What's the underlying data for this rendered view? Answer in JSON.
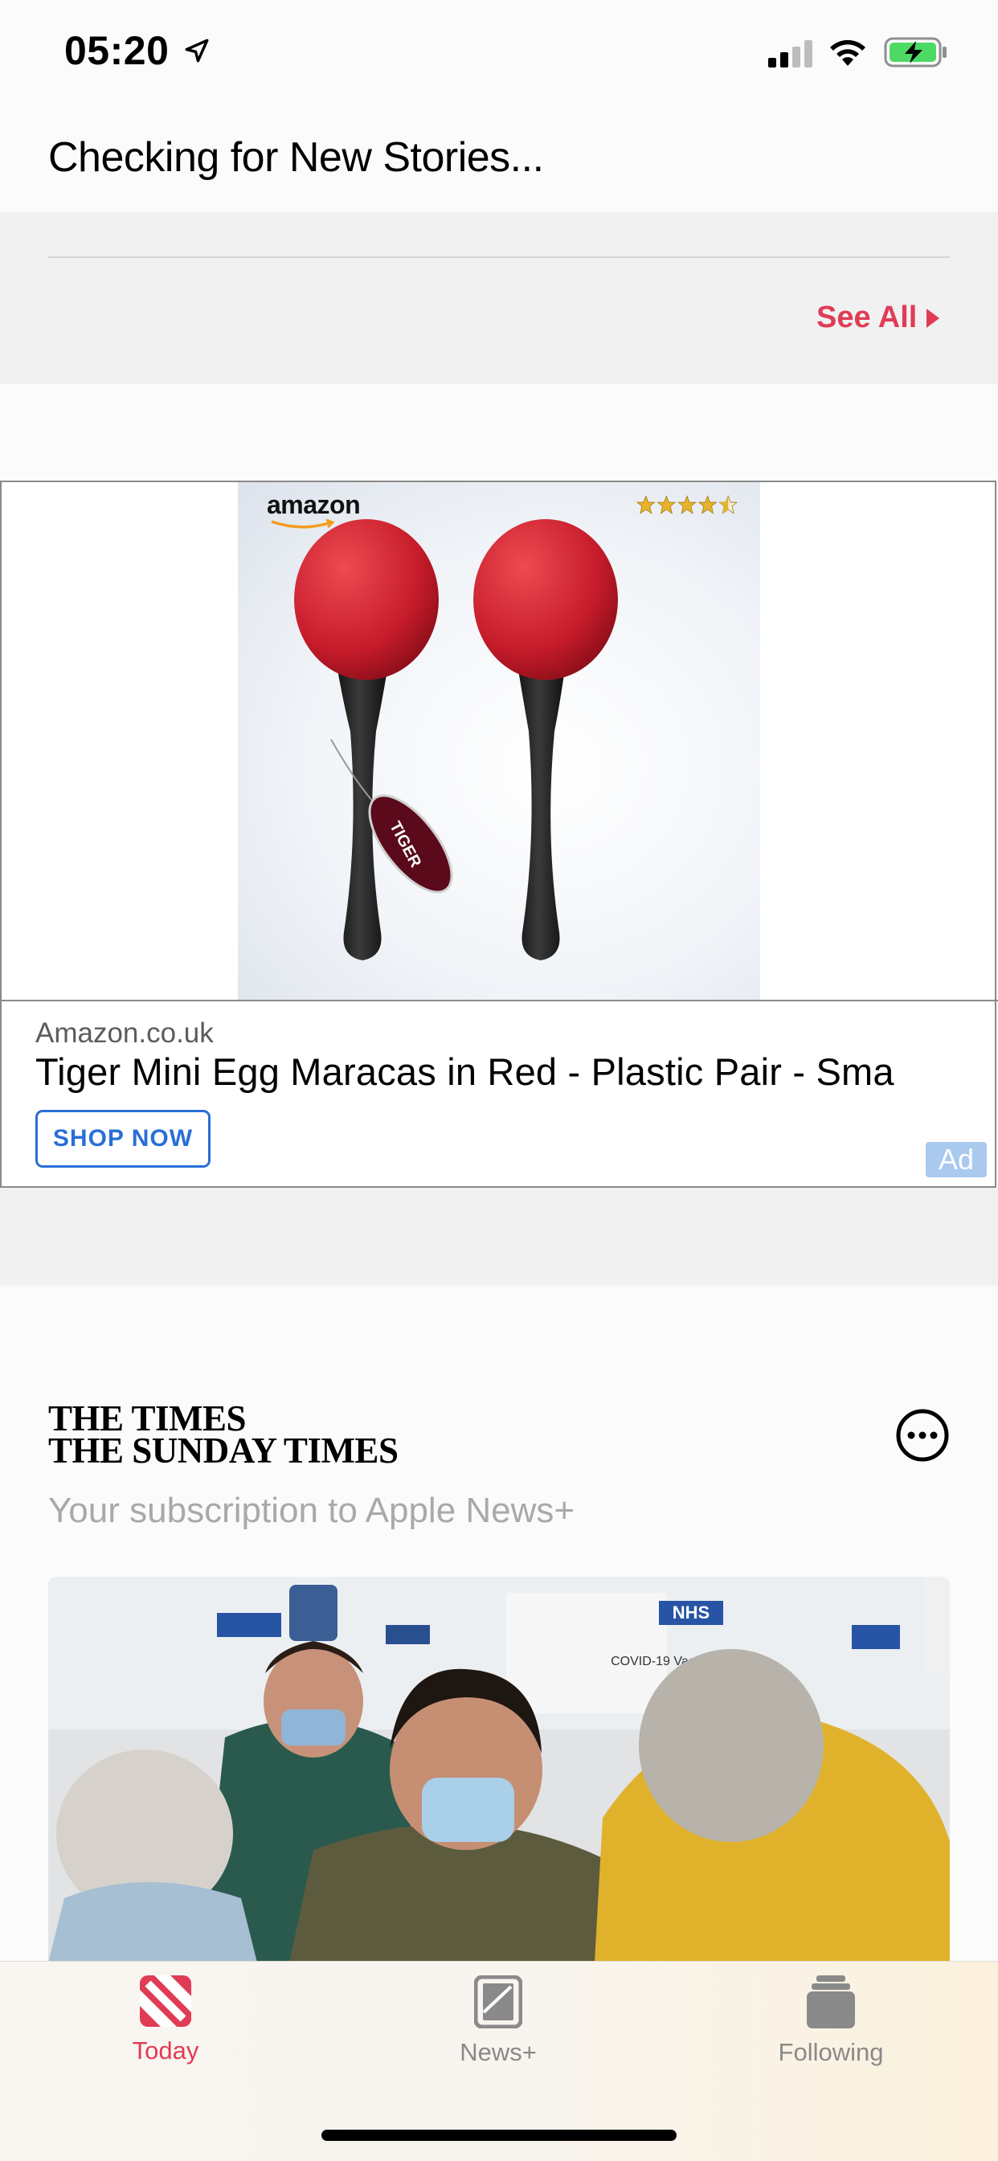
{
  "status_bar": {
    "time": "05:20",
    "battery_color": "#4cd964"
  },
  "header": {
    "title": "Checking for New Stories..."
  },
  "see_all": {
    "label": "See All",
    "color": "#e03c56"
  },
  "ad": {
    "image_brand": "amazon",
    "rating_stars": 4.5,
    "product_tag": "TIGER",
    "domain": "Amazon.co.uk",
    "title": "Tiger Mini Egg Maracas in Red - Plastic Pair - Sma",
    "cta": "SHOP NOW",
    "badge": "Ad",
    "accent_color": "#2a6fd6"
  },
  "publisher": {
    "logo_line1": "THE TIMES",
    "logo_line2": "THE SUNDAY TIMES",
    "subtitle": "Your subscription to Apple News+",
    "more_icon": "ellipsis-circle-icon",
    "photo_signs": [
      "NHS",
      "COVID-19 Vaccination"
    ]
  },
  "tab_bar": {
    "tabs": [
      {
        "label": "Today",
        "icon": "news-icon",
        "color": "#e03c56",
        "active": true
      },
      {
        "label": "News+",
        "icon": "news-plus-icon",
        "color": "#8a8a8a",
        "active": false
      },
      {
        "label": "Following",
        "icon": "following-icon",
        "color": "#8a8a8a",
        "active": false
      }
    ]
  }
}
